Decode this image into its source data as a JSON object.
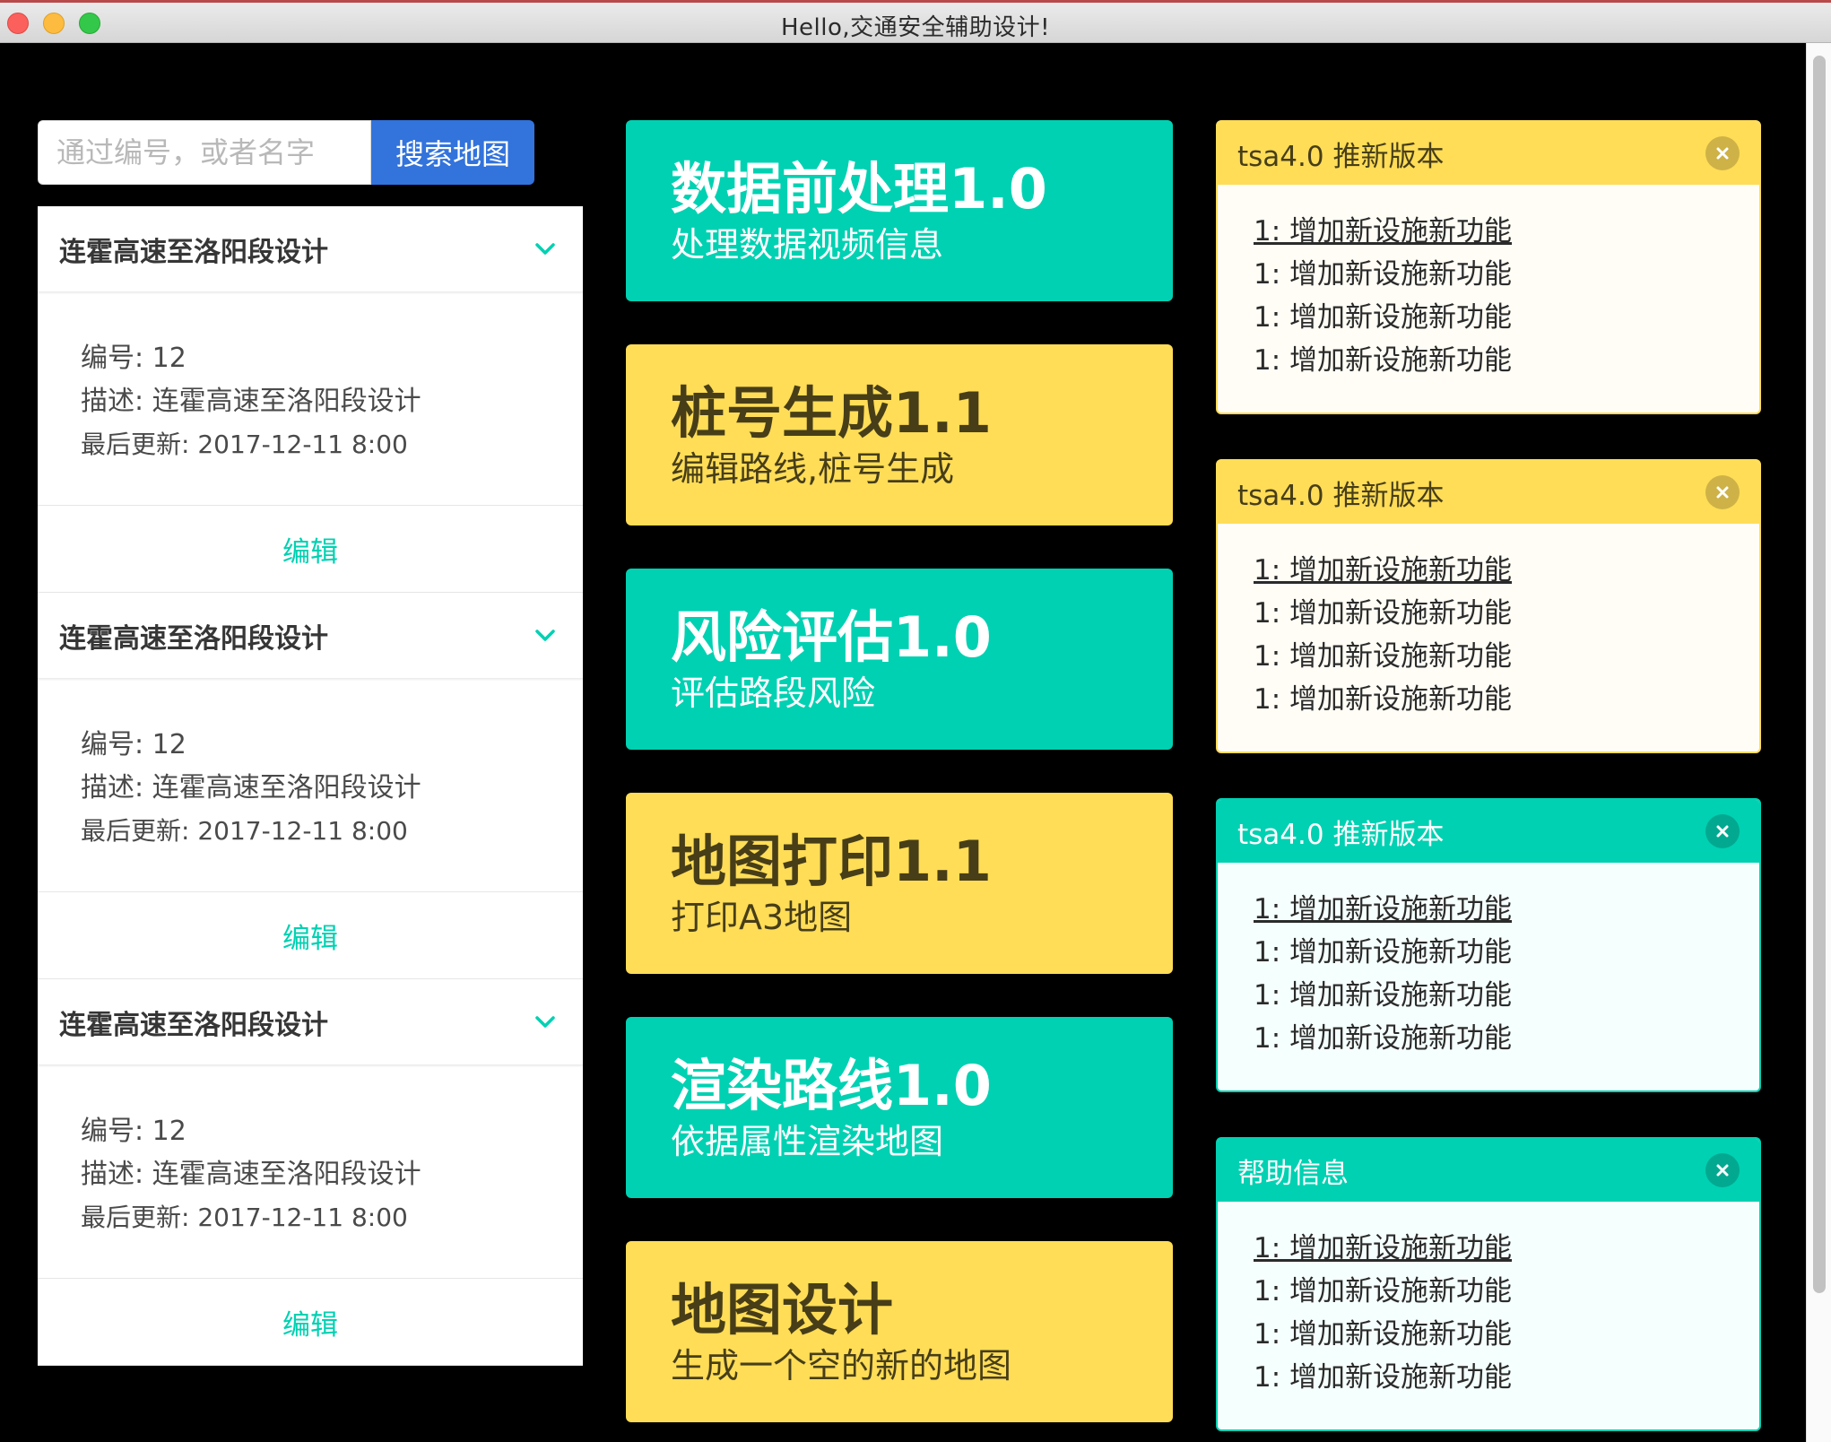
{
  "window": {
    "title": "Hello,交通安全辅助设计!"
  },
  "search": {
    "placeholder": "通过编号，或者名字",
    "button_label": "搜索地图"
  },
  "cards": [
    {
      "title": "连霍高速至洛阳段设计",
      "id_line": "编号: 12",
      "desc_line": "描述: 连霍高速至洛阳段设计",
      "updated_line": "最后更新: 2017-12-11 8:00",
      "edit_label": "编辑"
    },
    {
      "title": "连霍高速至洛阳段设计",
      "id_line": "编号: 12",
      "desc_line": "描述: 连霍高速至洛阳段设计",
      "updated_line": "最后更新: 2017-12-11 8:00",
      "edit_label": "编辑"
    },
    {
      "title": "连霍高速至洛阳段设计",
      "id_line": "编号: 12",
      "desc_line": "描述: 连霍高速至洛阳段设计",
      "updated_line": "最后更新: 2017-12-11 8:00",
      "edit_label": "编辑"
    }
  ],
  "tiles": [
    {
      "title": "数据前处理1.0",
      "subtitle": "处理数据视频信息",
      "color": "#00d1b2"
    },
    {
      "title": "桩号生成1.1",
      "subtitle": "编辑路线,桩号生成",
      "color": "#ffdd57"
    },
    {
      "title": "风险评估1.0",
      "subtitle": "评估路段风险",
      "color": "#00d1b2"
    },
    {
      "title": "地图打印1.1",
      "subtitle": "打印A3地图",
      "color": "#ffdd57"
    },
    {
      "title": "渲染路线1.0",
      "subtitle": "依据属性渲染地图",
      "color": "#00d1b2"
    },
    {
      "title": "地图设计",
      "subtitle": "生成一个空的新的地图",
      "color": "#ffdd57"
    }
  ],
  "messages": [
    {
      "header": "tsa4.0 推新版本",
      "items": [
        "1: 增加新设施新功能",
        "1: 增加新设施新功能",
        "1: 增加新设施新功能",
        "1: 增加新设施新功能"
      ],
      "color": "#ffdd57"
    },
    {
      "header": "tsa4.0 推新版本",
      "items": [
        "1: 增加新设施新功能",
        "1: 增加新设施新功能",
        "1: 增加新设施新功能",
        "1: 增加新设施新功能"
      ],
      "color": "#ffdd57"
    },
    {
      "header": "tsa4.0 推新版本",
      "items": [
        "1: 增加新设施新功能",
        "1: 增加新设施新功能",
        "1: 增加新设施新功能",
        "1: 增加新设施新功能"
      ],
      "color": "#00d1b2"
    },
    {
      "header": "帮助信息",
      "items": [
        "1: 增加新设施新功能",
        "1: 增加新设施新功能",
        "1: 增加新设施新功能",
        "1: 增加新设施新功能"
      ],
      "color": "#00d1b2"
    }
  ],
  "icons": {
    "card_toggle": "chevron-down-icon",
    "message_close": "close-icon"
  }
}
